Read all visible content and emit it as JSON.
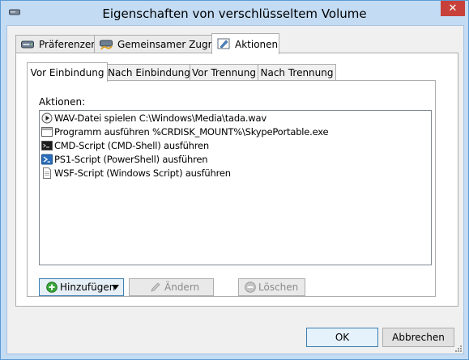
{
  "window": {
    "title": "Eigenschaften von verschlüsseltem Volume",
    "close_label": "✕"
  },
  "outer_tabs": [
    {
      "label": "Präferenzen",
      "icon": "drive-icon"
    },
    {
      "label": "Gemeinsamer Zugriff",
      "icon": "shared-drive-icon"
    },
    {
      "label": "Aktionen",
      "icon": "actions-icon",
      "active": true
    }
  ],
  "inner_tabs": [
    {
      "label": "Vor Einbindung",
      "active": true
    },
    {
      "label": "Nach Einbindung"
    },
    {
      "label": "Vor Trennung"
    },
    {
      "label": "Nach Trennung"
    }
  ],
  "actions": {
    "label": "Aktionen:",
    "items": [
      {
        "icon": "play-sound-icon",
        "text": "WAV-Datei spielen C:\\Windows\\Media\\tada.wav"
      },
      {
        "icon": "program-window-icon",
        "text": "Programm ausführen %CRDISK_MOUNT%\\SkypePortable.exe"
      },
      {
        "icon": "cmd-console-icon",
        "text": "CMD-Script (CMD-Shell) ausführen"
      },
      {
        "icon": "powershell-icon",
        "text": "PS1-Script (PowerShell) ausführen"
      },
      {
        "icon": "script-document-icon",
        "text": "WSF-Script (Windows Script) ausführen"
      }
    ]
  },
  "buttons": {
    "add": "Hinzufügen",
    "edit": "Ändern",
    "delete": "Löschen"
  },
  "footer": {
    "ok": "OK",
    "cancel": "Abbrechen"
  },
  "colors": {
    "titlebar": "#c3dbf3",
    "close": "#c7413a",
    "add_icon": "#3aa63a",
    "ps_icon": "#2a6ebb"
  }
}
